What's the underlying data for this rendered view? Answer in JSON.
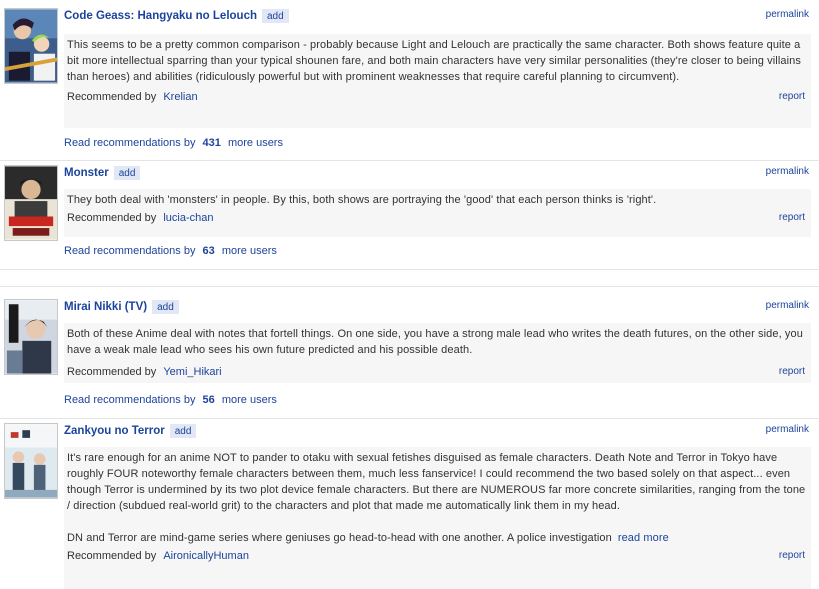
{
  "recommendations": [
    {
      "title": "Code Geass: Hangyaku no Lelouch",
      "add_label": "add",
      "permalink_label": "permalink",
      "body": [
        "This seems to be a pretty common comparison - probably because Light and Lelouch are practically the same character. Both shows feature quite a bit more intellectual sparring than your typical shounen fare, and both main characters have very similar personalities (they're closer to being villains than heroes) and abilities (ridiculously powerful but with prominent weaknesses that require careful planning to circumvent)."
      ],
      "recommended_by_label": "Recommended by",
      "user": "Krelian",
      "report_label": "report",
      "more_prefix": "Read recommendations by",
      "more_count": "431",
      "more_suffix": "more users"
    },
    {
      "title": "Monster",
      "add_label": "add",
      "permalink_label": "permalink",
      "body": [
        "They both deal with 'monsters' in people. By this, both shows are portraying the 'good' that each person thinks is 'right'."
      ],
      "recommended_by_label": "Recommended by",
      "user": "lucia-chan",
      "report_label": "report",
      "more_prefix": "Read recommendations by",
      "more_count": "63",
      "more_suffix": "more users"
    },
    {
      "title": "Mirai Nikki (TV)",
      "add_label": "add",
      "permalink_label": "permalink",
      "body": [
        "Both of these Anime deal with notes that fortell things. On one side, you have a strong male lead who writes the death futures, on the other side, you have a weak male lead who sees his own future predicted and his possible death."
      ],
      "recommended_by_label": "Recommended by",
      "user": "Yemi_Hikari",
      "report_label": "report",
      "more_prefix": "Read recommendations by",
      "more_count": "56",
      "more_suffix": "more users"
    },
    {
      "title": "Zankyou no Terror",
      "add_label": "add",
      "permalink_label": "permalink",
      "body": [
        "It's rare enough for an anime NOT to pander to otaku with sexual fetishes disguised as female characters. Death Note and Terror in Tokyo have roughly FOUR noteworthy female characters between them, much less fanservice! I could recommend the two based solely on that aspect... even though Terror is undermined by its two plot device female characters. But there are NUMEROUS far more concrete similarities, ranging from the tone / direction (subdued real-world grit) to the characters and plot that made me automatically link them in my head.",
        "DN and Terror are mind-game series where geniuses go head-to-head with one another. A police investigation"
      ],
      "read_more_label": "read more",
      "recommended_by_label": "Recommended by",
      "user": "AironicallyHuman",
      "report_label": "report"
    }
  ],
  "colors": {
    "link": "#1c439b",
    "text": "#323232",
    "panel": "#f6f6f6",
    "add_bg": "#e1e7f5"
  }
}
